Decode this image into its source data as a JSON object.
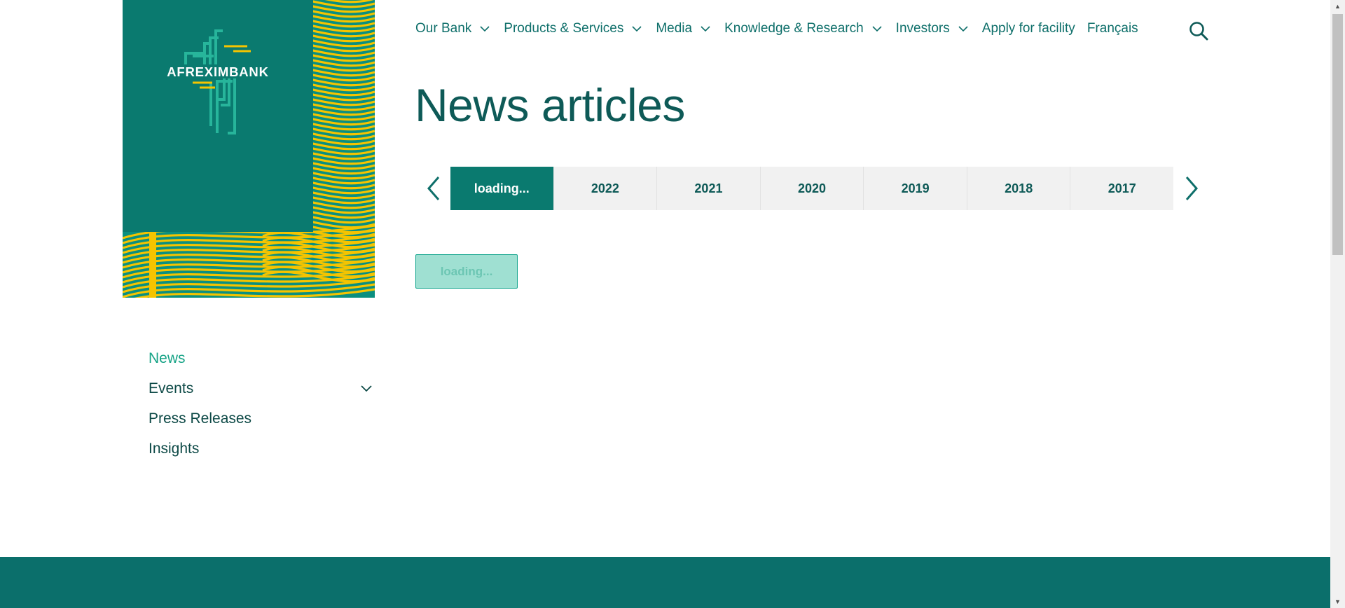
{
  "brand": {
    "name": "AFREXIMBANK",
    "colors": {
      "primary": "#0a7a6f",
      "accent": "#f5c400",
      "light": "#9fe0d2"
    }
  },
  "topnav": {
    "items": [
      {
        "label": "Our Bank",
        "has_dropdown": true
      },
      {
        "label": "Products & Services",
        "has_dropdown": true
      },
      {
        "label": "Media",
        "has_dropdown": true
      },
      {
        "label": "Knowledge & Research",
        "has_dropdown": true
      },
      {
        "label": "Investors",
        "has_dropdown": true
      },
      {
        "label": "Apply for facility",
        "has_dropdown": false
      },
      {
        "label": "Français",
        "has_dropdown": false
      }
    ],
    "search_icon": "search-icon"
  },
  "page": {
    "title": "News articles"
  },
  "years": {
    "tabs": [
      {
        "label": "loading...",
        "active": true
      },
      {
        "label": "2022"
      },
      {
        "label": "2021"
      },
      {
        "label": "2020"
      },
      {
        "label": "2019"
      },
      {
        "label": "2018"
      },
      {
        "label": "2017"
      }
    ],
    "prev_icon": "chevron-left-icon",
    "next_icon": "chevron-right-icon"
  },
  "content": {
    "loading_button": "loading..."
  },
  "sidenav": {
    "items": [
      {
        "label": "News",
        "active": true
      },
      {
        "label": "Events",
        "has_dropdown": true
      },
      {
        "label": "Press Releases"
      },
      {
        "label": "Insights"
      }
    ]
  }
}
